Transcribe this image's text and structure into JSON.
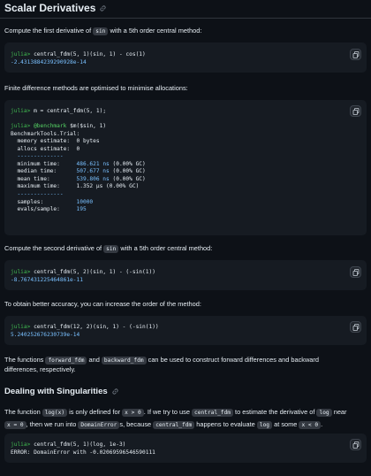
{
  "section1": {
    "title": "Scalar Derivatives"
  },
  "p1": {
    "a": "Compute the first derivative of ",
    "code": "sin",
    "b": " with a 5th order central method:"
  },
  "code1": {
    "prompt": "julia>",
    "input": " central_fdm(5, 1)(sin, 1) - cos(1)",
    "output": "-2.4313884239290928e-14"
  },
  "p2": {
    "text": "Finite difference methods are optimised to minimise allocations:"
  },
  "code2": {
    "line1_prompt": "julia>",
    "line1": " m = central_fdm(5, 1);",
    "line2_prompt": "julia>",
    "line2_macro": " @benchmark",
    "line2_rest": " $m($sin, 1)",
    "header": "BenchmarkTools.Trial:",
    "mem_label": "  memory estimate:",
    "mem_value": "  0 bytes",
    "alloc_label": "  allocs estimate:",
    "alloc_value": "  0",
    "sep1": "  --------------",
    "min_label": "  minimum time:",
    "min_value": "     486.621 ns",
    "min_gc": " (0.00% GC)",
    "med_label": "  median time:",
    "med_value": "      507.677 ns",
    "med_gc": " (0.00% GC)",
    "mean_label": "  mean time:",
    "mean_value": "        539.806 ns",
    "mean_gc": " (0.00% GC)",
    "max_label": "  maximum time:",
    "max_value": "     1.352 μs (0.00% GC)",
    "sep2": "  --------------",
    "samples_label": "  samples:",
    "samples_value": "          10000",
    "evals_label": "  evals/sample:",
    "evals_value": "     195"
  },
  "p3": {
    "a": "Compute the second derivative of ",
    "code": "sin",
    "b": " with a 5th order central method:"
  },
  "code3": {
    "prompt": "julia>",
    "input": " central_fdm(5, 2)(sin, 1) - (-sin(1))",
    "output": "-8.767431225464861e-11"
  },
  "p4": {
    "text": "To obtain better accuracy, you can increase the order of the method:"
  },
  "code4": {
    "prompt": "julia>",
    "input": " central_fdm(12, 2)(sin, 1) - (-sin(1))",
    "output": "5.240252676230739e-14"
  },
  "p5": {
    "a": "The functions ",
    "code1": "forward_fdm",
    "b": " and ",
    "code2": "backward_fdm",
    "c": " can be used to construct forward differences and backward",
    "d": "differences, respectively."
  },
  "section2": {
    "title": "Dealing with Singularities"
  },
  "p6": {
    "a": "The function ",
    "c1": "log(x)",
    "b": " is only defined for ",
    "c2": "x > 0",
    "c": ". If we try to use ",
    "c3": "central_fdm",
    "d": " to estimate the derivative of ",
    "c4": "log",
    "e": " near",
    "c5": "x = 0",
    "f": ", then we run into ",
    "c6": "DomainError",
    "g": "s, because ",
    "c7": "central_fdm",
    "h": " happens to evaluate ",
    "c8": "log",
    "i": " at some ",
    "c9": "x < 0",
    "j": "."
  },
  "code5": {
    "prompt": "julia>",
    "input": " central_fdm(5, 1)(log, 1e-3)",
    "output": "ERROR: DomainError with -0.02069596546590111"
  },
  "icons": {
    "copy": "copy-icon",
    "link": "link-icon"
  }
}
